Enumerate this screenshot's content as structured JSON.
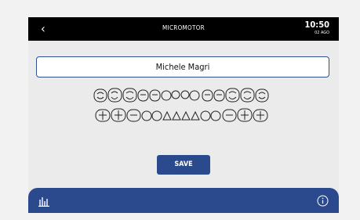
{
  "header": {
    "back_icon": "chevron-left-icon",
    "title": "MICROMOTOR",
    "time": "10:50",
    "date": "02 AGO"
  },
  "patient": {
    "name": "Michele Magri"
  },
  "odontogram": {
    "upper_teeth_count": 14,
    "lower_teeth_count": 14
  },
  "actions": {
    "save_label": "SAVE"
  },
  "footer": {
    "left_icon": "bar-chart-icon",
    "right_icon": "info-icon"
  },
  "colors": {
    "accent": "#2b4a8e",
    "header_bg": "#000000",
    "screen_bg": "#ebebeb"
  }
}
